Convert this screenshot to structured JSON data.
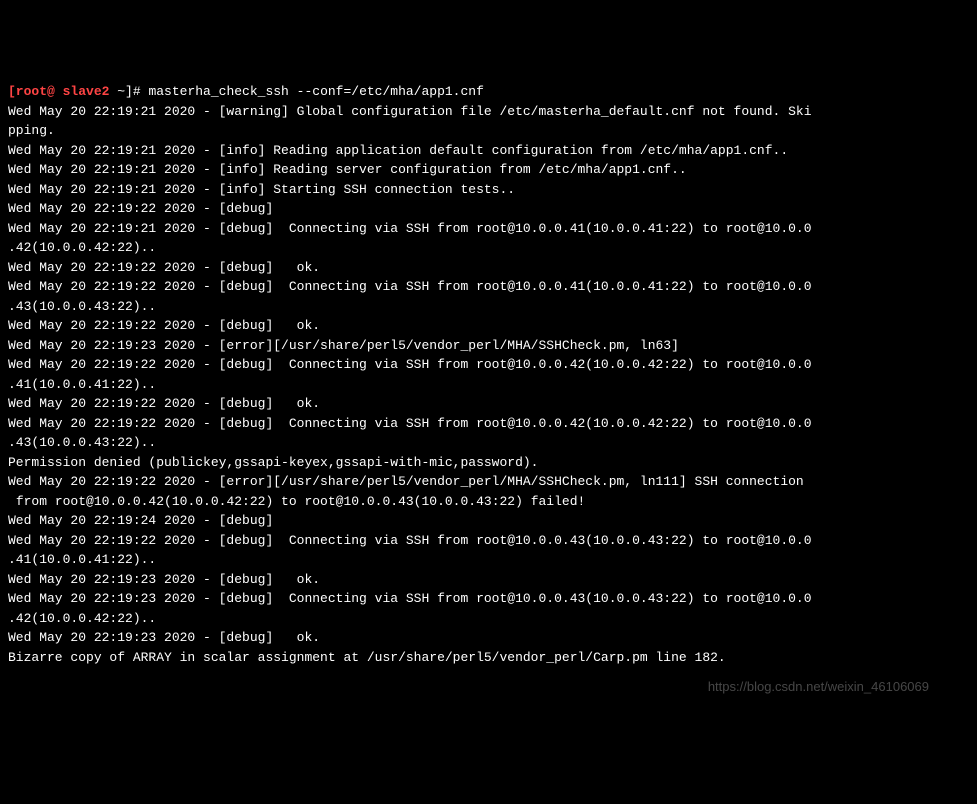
{
  "prompt": {
    "user": "[root@ slave2 ",
    "tilde": "~",
    "symbol": "]# ",
    "command": "masterha_check_ssh --conf=/etc/mha/app1.cnf"
  },
  "lines": {
    "l0": "Wed May 20 22:19:21 2020 - [warning] Global configuration file /etc/masterha_default.cnf not found. Ski",
    "l1": "pping.",
    "l2": "Wed May 20 22:19:21 2020 - [info] Reading application default configuration from /etc/mha/app1.cnf..",
    "l3": "Wed May 20 22:19:21 2020 - [info] Reading server configuration from /etc/mha/app1.cnf..",
    "l4": "Wed May 20 22:19:21 2020 - [info] Starting SSH connection tests..",
    "l5": "Wed May 20 22:19:22 2020 - [debug] ",
    "l6": "Wed May 20 22:19:21 2020 - [debug]  Connecting via SSH from root@10.0.0.41(10.0.0.41:22) to root@10.0.0",
    "l7": ".42(10.0.0.42:22)..",
    "l8": "Wed May 20 22:19:22 2020 - [debug]   ok.",
    "l9": "Wed May 20 22:19:22 2020 - [debug]  Connecting via SSH from root@10.0.0.41(10.0.0.41:22) to root@10.0.0",
    "l10": ".43(10.0.0.43:22)..",
    "l11": "Wed May 20 22:19:22 2020 - [debug]   ok.",
    "l12": "Wed May 20 22:19:23 2020 - [error][/usr/share/perl5/vendor_perl/MHA/SSHCheck.pm, ln63] ",
    "l13": "Wed May 20 22:19:22 2020 - [debug]  Connecting via SSH from root@10.0.0.42(10.0.0.42:22) to root@10.0.0",
    "l14": ".41(10.0.0.41:22)..",
    "l15": "Wed May 20 22:19:22 2020 - [debug]   ok.",
    "l16": "Wed May 20 22:19:22 2020 - [debug]  Connecting via SSH from root@10.0.0.42(10.0.0.42:22) to root@10.0.0",
    "l17": ".43(10.0.0.43:22)..",
    "l18": "Permission denied (publickey,gssapi-keyex,gssapi-with-mic,password).",
    "l19": "Wed May 20 22:19:22 2020 - [error][/usr/share/perl5/vendor_perl/MHA/SSHCheck.pm, ln111] SSH connection",
    "l20": " from root@10.0.0.42(10.0.0.42:22) to root@10.0.0.43(10.0.0.43:22) failed!",
    "l21": "Wed May 20 22:19:24 2020 - [debug] ",
    "l22": "Wed May 20 22:19:22 2020 - [debug]  Connecting via SSH from root@10.0.0.43(10.0.0.43:22) to root@10.0.0",
    "l23": ".41(10.0.0.41:22)..",
    "l24": "Wed May 20 22:19:23 2020 - [debug]   ok.",
    "l25": "Wed May 20 22:19:23 2020 - [debug]  Connecting via SSH from root@10.0.0.43(10.0.0.43:22) to root@10.0.0",
    "l26": ".42(10.0.0.42:22)..",
    "l27": "Wed May 20 22:19:23 2020 - [debug]   ok.",
    "l28": "Bizarre copy of ARRAY in scalar assignment at /usr/share/perl5/vendor_perl/Carp.pm line 182."
  },
  "watermark": "https://blog.csdn.net/weixin_46106069"
}
